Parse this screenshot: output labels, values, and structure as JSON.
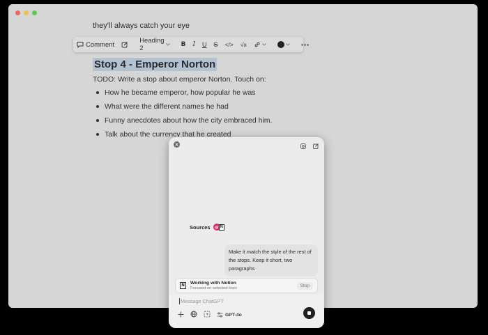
{
  "document": {
    "previous_line": "they'll always catch your eye",
    "heading": "Stop 4 - Emperor Norton",
    "todo": "TODO: Write a stop about emperor Norton. Touch on:",
    "bullets": [
      "How he became emperor, how popular he was",
      "What were the different names he had",
      "Funny anecdotes about how the city embraced him.",
      "Talk about the currency that he created"
    ]
  },
  "toolbar": {
    "comment_label": "Comment",
    "block_type": "Heading 2",
    "bold": "B",
    "italic": "I",
    "underline": "U",
    "strike": "S",
    "code": "</>",
    "math": "√x",
    "text_color": "#222222"
  },
  "chat": {
    "sources_label": "Sources",
    "message": "Make it match the style of the rest of the stops. Keep it short, two paragraphs",
    "context_title": "Working with Notion",
    "context_subtitle": "Focused on selected lines",
    "context_stop": "Stop",
    "input_placeholder": "Message ChatGPT",
    "model": "GPT-4o"
  },
  "colors": {
    "selection": "#b3c2d3",
    "window_bg": "#d6d6d6",
    "panel_bg": "#ececec"
  }
}
